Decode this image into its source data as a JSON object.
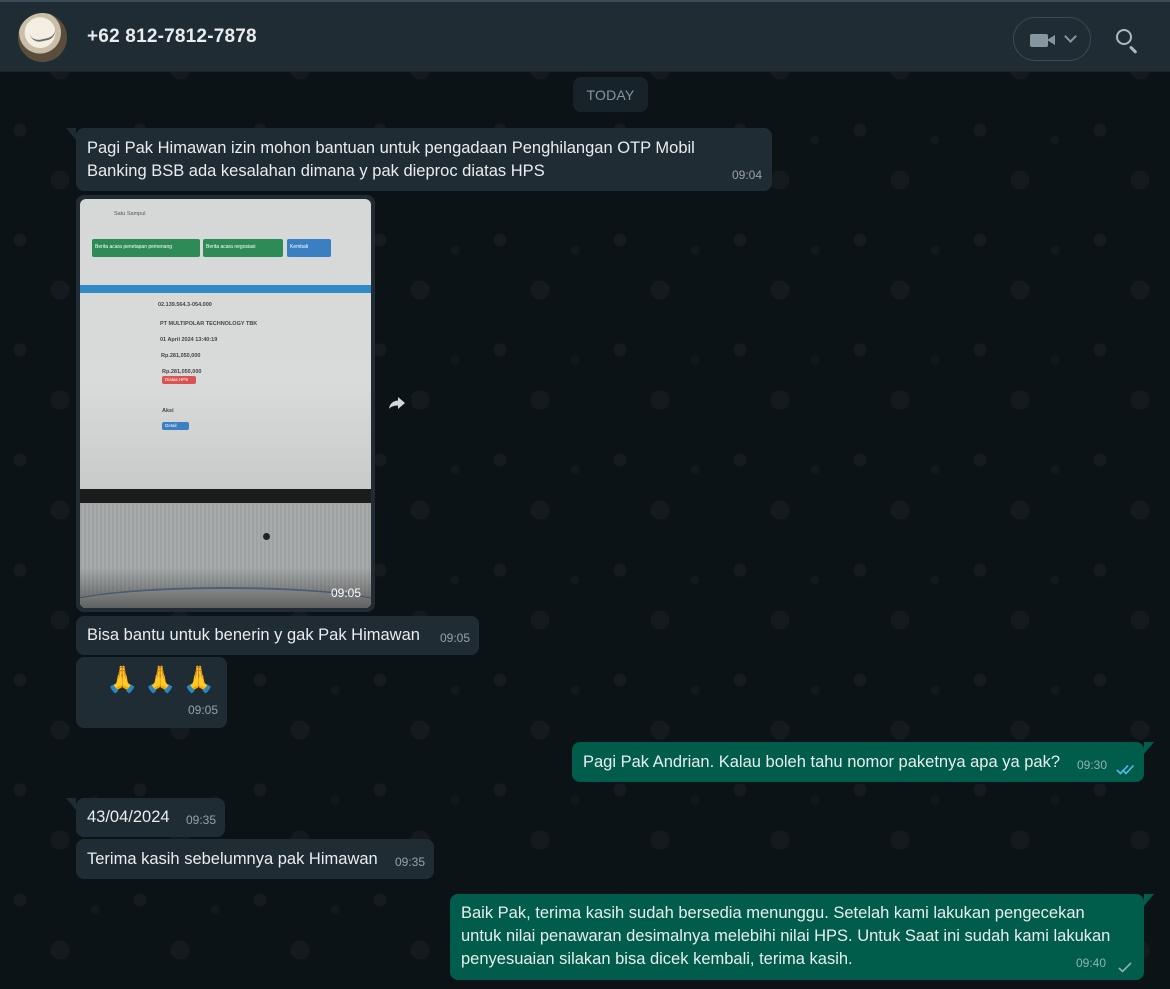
{
  "header": {
    "contact_name": "+62 812-7812-7878",
    "avatar_icon": "avatar-image",
    "video_call_icon": "video-camera-icon",
    "call_dropdown_icon": "chevron-down-icon",
    "search_icon": "search-icon"
  },
  "date_divider": "TODAY",
  "messages": [
    {
      "direction": "in",
      "type": "text",
      "text": "Pagi Pak Himawan izin mohon bantuan untuk pengadaan Penghilangan OTP Mobil Banking BSB  ada kesalahan dimana y pak dieproc diatas HPS",
      "time": "09:04"
    },
    {
      "direction": "in",
      "type": "image",
      "time": "09:05",
      "image": {
        "heading": "Satu Sampul",
        "buttons": [
          "Berita acara penetapan pemenang",
          "Berita acara negosiasi",
          "Kembali"
        ],
        "lines": [
          "02.139.564.3-054.000",
          "PT MULTIPOLAR TECHNOLOGY TBK",
          "01 April 2024 13:40:19",
          "Rp.281,050,000",
          "Rp.281,050,000"
        ],
        "tag": "Diatas HPS",
        "aksi_label": "Aksi",
        "detail_button": "Detail"
      }
    },
    {
      "direction": "in",
      "type": "text",
      "text": "Bisa bantu untuk benerin y gak Pak Himawan",
      "time": "09:05"
    },
    {
      "direction": "in",
      "type": "emoji",
      "text": "🙏🙏🙏",
      "time": "09:05"
    },
    {
      "direction": "out",
      "type": "text",
      "text": "Pagi Pak Andrian. Kalau boleh tahu nomor paketnya apa ya pak?",
      "time": "09:30",
      "status_icon": "double-check-read-icon"
    },
    {
      "direction": "in",
      "type": "text",
      "text": "43/04/2024",
      "time": "09:35"
    },
    {
      "direction": "in",
      "type": "text",
      "text": "Terima kasih sebelumnya pak Himawan",
      "time": "09:35"
    },
    {
      "direction": "out",
      "type": "text",
      "text": "Baik  Pak, terima kasih sudah bersedia menunggu. Setelah kami lakukan pengecekan untuk nilai penawaran desimalnya melebihi nilai HPS. Untuk Saat ini sudah kami lakukan penyesuaian silakan bisa dicek kembali, terima kasih.",
      "time": "09:40",
      "status_icon": "single-check-sent-icon"
    }
  ],
  "forward_icon": "forward-arrow-icon",
  "colors": {
    "header_bg": "#202c33",
    "incoming_bubble": "#202c33",
    "outgoing_bubble": "#005c4b",
    "read_tick": "#53bdeb",
    "background": "#0b141a"
  }
}
